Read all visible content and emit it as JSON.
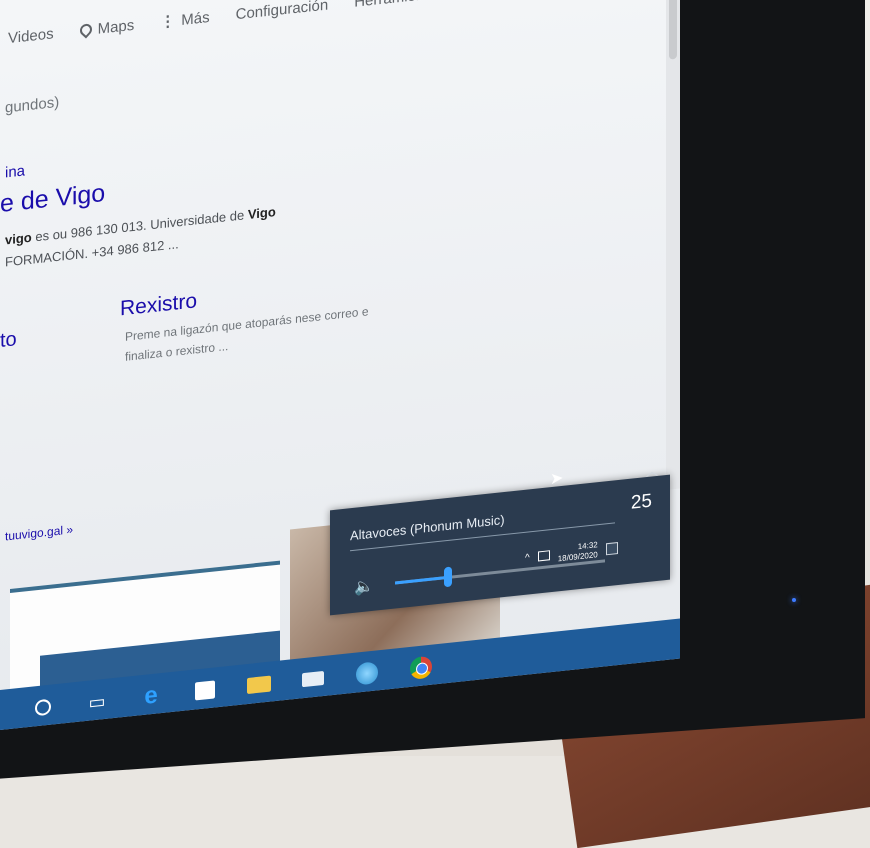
{
  "nav": {
    "videos": "Videos",
    "maps": "Maps",
    "more": "Más",
    "settings": "Configuración",
    "tools": "Herramientas"
  },
  "stats_text": "gundos)",
  "crumb": "ina",
  "result": {
    "title": "e de Vigo",
    "snippet_prefix": "vigo",
    "snippet_line1": " es ou 986 130 013. Universidade de ",
    "snippet_bold": "Vigo",
    "snippet_line2": "FORMACIÓN. +34 986 812 ..."
  },
  "sitelinks": {
    "left_fragment": "to",
    "title": "Rexistro",
    "description": "Preme na ligazón que atoparás nese correo e finaliza o rexistro ..."
  },
  "more_link": "tuuvigo.gal »",
  "volume_flyout": {
    "device": "Altavoces (Phonum Music)",
    "level_text": "25",
    "level_fraction": 0.25
  },
  "tray": {
    "time": "14:32",
    "date": "18/09/2020"
  },
  "icons": {
    "maps": "pin-icon",
    "speaker": "speaker-icon",
    "expand": "chevron-up-icon",
    "cursor": "mouse-cursor-icon"
  },
  "colors": {
    "taskbar": "#1f5c9a",
    "flyout_bg": "#2b3b4f",
    "slider_accent": "#3aa0ff",
    "link": "#1a0dab"
  }
}
